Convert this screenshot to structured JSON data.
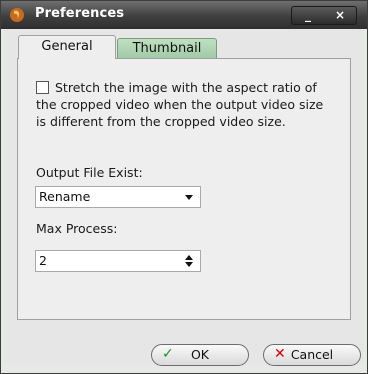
{
  "window": {
    "title": "Preferences",
    "minimize_glyph": "_",
    "close_glyph": "×"
  },
  "tabs": [
    {
      "label": "General",
      "selected": true
    },
    {
      "label": "Thumbnail",
      "selected": false
    }
  ],
  "general": {
    "stretch_checkbox": {
      "checked": false,
      "label": "Stretch the image with the aspect ratio of the cropped video when the output video size is different from the cropped video size."
    },
    "output_file_exist": {
      "label": "Output File Exist:",
      "value": "Rename"
    },
    "max_process": {
      "label": "Max Process:",
      "value": "2"
    }
  },
  "buttons": {
    "ok": {
      "label": "OK",
      "icon": "check-icon",
      "glyph": "✓"
    },
    "cancel": {
      "label": "Cancel",
      "icon": "x-icon",
      "glyph": "✕"
    }
  },
  "colors": {
    "ok_check": "#1f8f2a",
    "cancel_x": "#d10000",
    "thumbnail_tab": "#a9d3ae"
  }
}
